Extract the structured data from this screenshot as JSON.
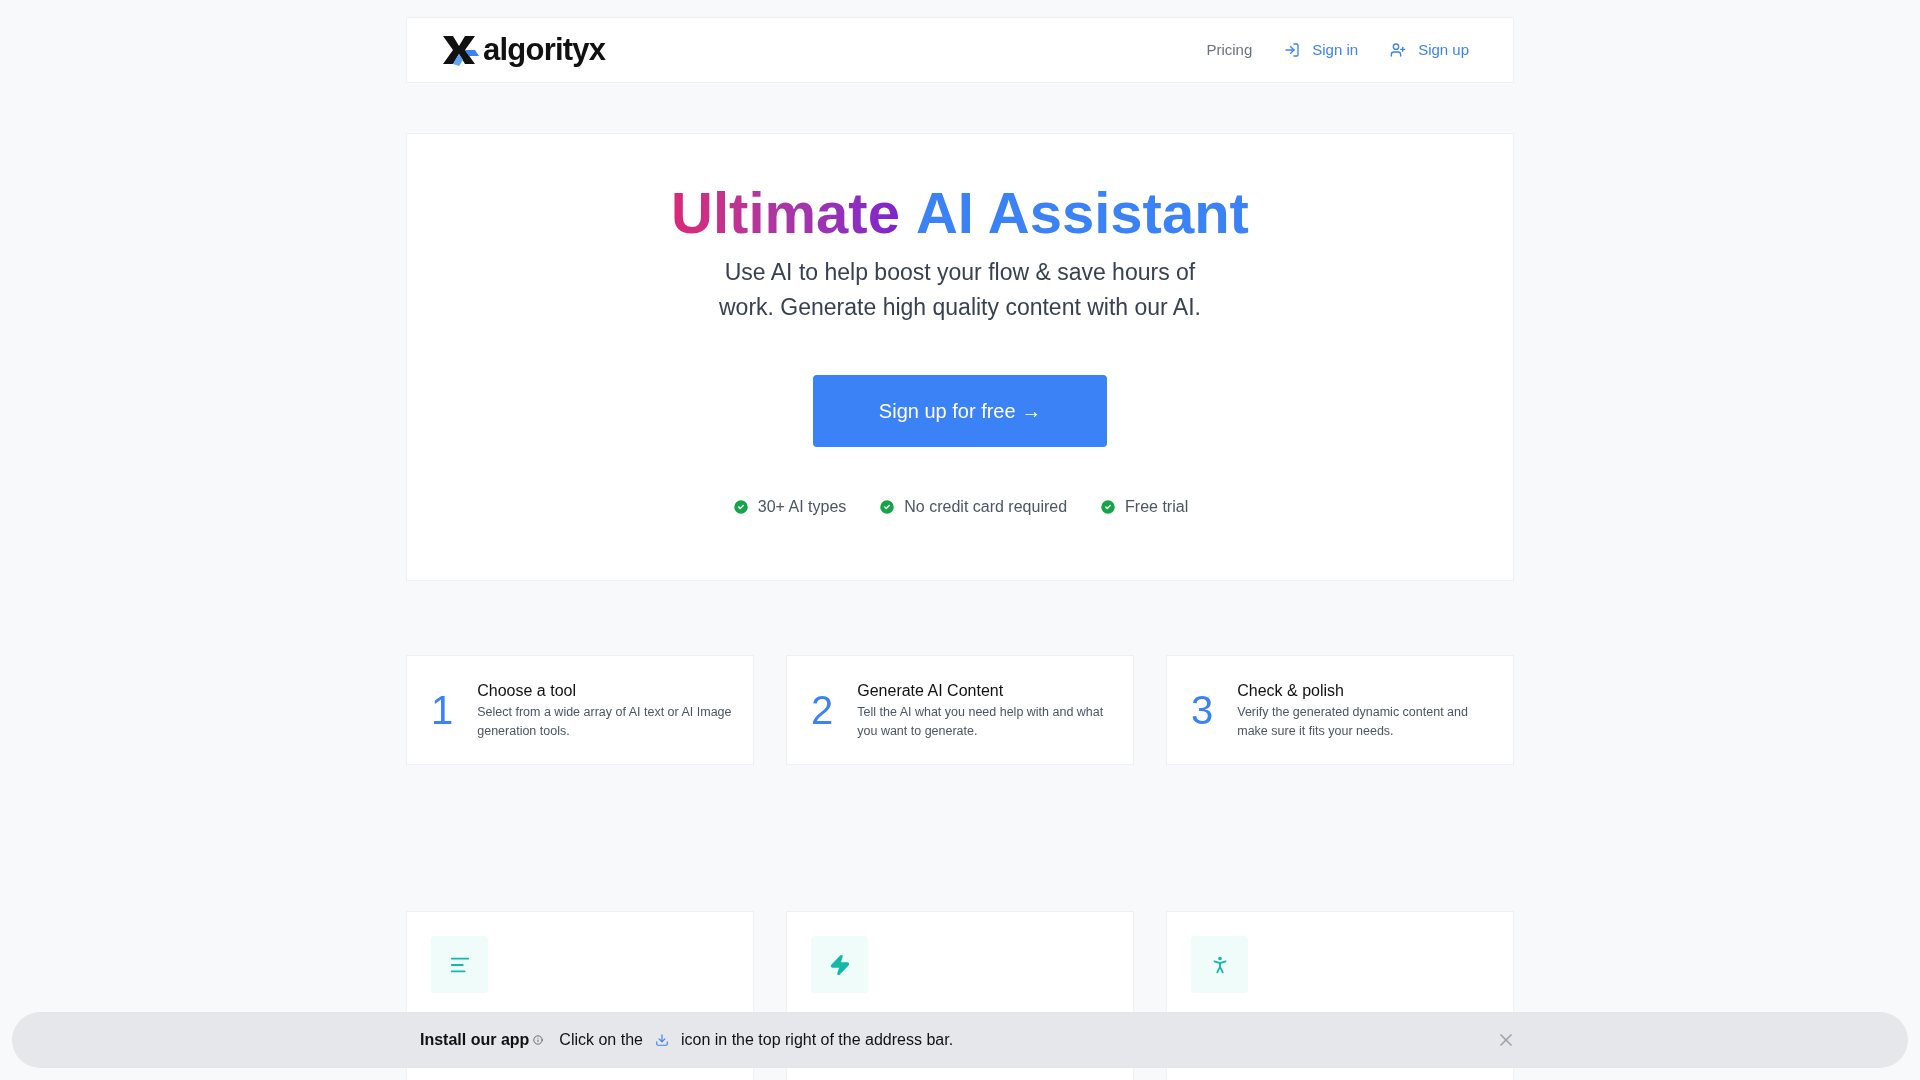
{
  "header": {
    "brand": "algorityx",
    "nav": [
      {
        "label": "Pricing",
        "kind": "plain"
      },
      {
        "label": "Sign in",
        "kind": "signin"
      },
      {
        "label": "Sign up",
        "kind": "signup"
      }
    ]
  },
  "hero": {
    "title_parts": [
      {
        "text": "Ultimate",
        "kind": "gradient"
      },
      {
        "text": "AI Assistant",
        "kind": "blue"
      }
    ],
    "subtitle": "Use AI to help boost your flow & save hours of work. Generate high quality content with our AI.",
    "cta": "Sign up for free →",
    "perks": [
      "30+ AI types",
      "No credit card required",
      "Free trial"
    ]
  },
  "steps": [
    {
      "number": "1",
      "title": "Choose a tool",
      "text": "Select from a wide array of AI text or AI Image generation tools."
    },
    {
      "number": "2",
      "title": "Generate AI Content",
      "text": "Tell the AI what you need help with and what you want to generate."
    },
    {
      "number": "3",
      "title": "Check & polish",
      "text": "Verify the generated dynamic content and make sure it fits your needs."
    }
  ],
  "features": [
    {
      "kind": "text"
    },
    {
      "kind": "bolt"
    },
    {
      "kind": "person"
    }
  ],
  "install_bar": {
    "title": "Install our app",
    "text_before": "Click on the",
    "text_after": "icon in the top right of the address bar."
  }
}
